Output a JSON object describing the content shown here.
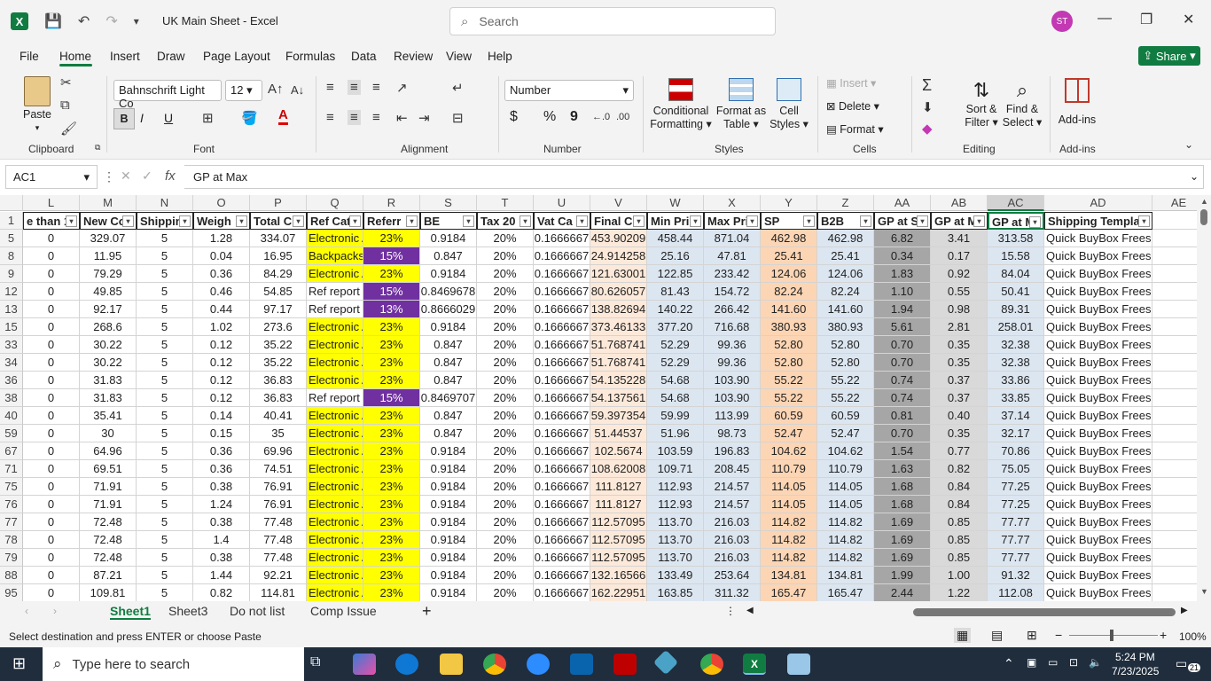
{
  "window": {
    "doc_title": "UK Main Sheet  -  Excel",
    "search_placeholder": "Search",
    "avatar": "ST",
    "minimize": "—",
    "maximize": "❐",
    "close": "✕"
  },
  "menu": {
    "file": "File",
    "home": "Home",
    "insert": "Insert",
    "draw": "Draw",
    "page_layout": "Page Layout",
    "formulas": "Formulas",
    "data": "Data",
    "review": "Review",
    "view": "View",
    "help": "Help",
    "share": "Share"
  },
  "ribbon": {
    "clipboard": {
      "paste": "Paste",
      "label": "Clipboard"
    },
    "font": {
      "name": "Bahnschrift Light Co",
      "size": "12",
      "label": "Font",
      "bold": "B",
      "italic": "I",
      "underline": "U"
    },
    "alignment": {
      "label": "Alignment"
    },
    "number": {
      "format": "Number",
      "label": "Number",
      "currency": "$",
      "percent": "%",
      "comma": "9"
    },
    "styles": {
      "conditional": "Conditional",
      "conditional2": "Formatting",
      "format_as": "Format as",
      "format_as2": "Table",
      "cell": "Cell",
      "cell2": "Styles",
      "label": "Styles"
    },
    "cells": {
      "insert": "Insert",
      "delete": "Delete",
      "format": "Format",
      "label": "Cells"
    },
    "editing": {
      "sort": "Sort &",
      "sort2": "Filter",
      "find": "Find &",
      "find2": "Select",
      "label": "Editing"
    },
    "addins": {
      "addins": "Add-ins",
      "label": "Add-ins"
    }
  },
  "formula_bar": {
    "name_box": "AC1",
    "content": "GP at Max",
    "fx": "fx"
  },
  "columns": [
    "L",
    "M",
    "N",
    "O",
    "P",
    "Q",
    "R",
    "S",
    "T",
    "U",
    "V",
    "W",
    "X",
    "Y",
    "Z",
    "AA",
    "AB",
    "AC",
    "AD",
    "AE"
  ],
  "headers": [
    "e than 1",
    "New Co",
    "Shippin",
    "Weigh",
    "Total C",
    "Ref Cat",
    "Referr",
    "BE",
    "Tax 20",
    "Vat Ca",
    "Final C",
    "Min Pri",
    "Max Pri",
    "SP",
    "B2B",
    "GP at S",
    "GP at M",
    "GP at M",
    "Shipping Templa"
  ],
  "row_numbers": [
    "1",
    "5",
    "8",
    "9",
    "12",
    "13",
    "15",
    "33",
    "34",
    "36",
    "38",
    "40",
    "59",
    "67",
    "71",
    "75",
    "76",
    "77",
    "78",
    "79",
    "88",
    "95"
  ],
  "rows": [
    [
      "0",
      "329.07",
      "5",
      "1.28",
      "334.07",
      "Electronic A",
      "23%",
      "0.9184",
      "20%",
      "0.1666667",
      "453.90209",
      "458.44",
      "871.04",
      "462.98",
      "462.98",
      "6.82",
      "3.41",
      "313.58",
      "Quick BuyBox Freeship"
    ],
    [
      "0",
      "11.95",
      "5",
      "0.04",
      "16.95",
      "Backpacks a",
      "15%",
      "0.847",
      "20%",
      "0.1666667",
      "24.914258",
      "25.16",
      "47.81",
      "25.41",
      "25.41",
      "0.34",
      "0.17",
      "15.58",
      "Quick BuyBox Freeship"
    ],
    [
      "0",
      "79.29",
      "5",
      "0.36",
      "84.29",
      "Electronic A",
      "23%",
      "0.9184",
      "20%",
      "0.1666667",
      "121.63001",
      "122.85",
      "233.42",
      "124.06",
      "124.06",
      "1.83",
      "0.92",
      "84.04",
      "Quick BuyBox Freeship"
    ],
    [
      "0",
      "49.85",
      "5",
      "0.46",
      "54.85",
      "Ref report",
      "15%",
      "0.8469678",
      "20%",
      "0.1666667",
      "80.626057",
      "81.43",
      "154.72",
      "82.24",
      "82.24",
      "1.10",
      "0.55",
      "50.41",
      "Quick BuyBox Freeship"
    ],
    [
      "0",
      "92.17",
      "5",
      "0.44",
      "97.17",
      "Ref report",
      "13%",
      "0.8666029",
      "20%",
      "0.1666667",
      "138.82694",
      "140.22",
      "266.42",
      "141.60",
      "141.60",
      "1.94",
      "0.98",
      "89.31",
      "Quick BuyBox Freeship"
    ],
    [
      "0",
      "268.6",
      "5",
      "1.02",
      "273.6",
      "Electronic A",
      "23%",
      "0.9184",
      "20%",
      "0.1666667",
      "373.46133",
      "377.20",
      "716.68",
      "380.93",
      "380.93",
      "5.61",
      "2.81",
      "258.01",
      "Quick BuyBox Freeship"
    ],
    [
      "0",
      "30.22",
      "5",
      "0.12",
      "35.22",
      "Electronic A",
      "23%",
      "0.847",
      "20%",
      "0.1666667",
      "51.768741",
      "52.29",
      "99.36",
      "52.80",
      "52.80",
      "0.70",
      "0.35",
      "32.38",
      "Quick BuyBox Freeship"
    ],
    [
      "0",
      "30.22",
      "5",
      "0.12",
      "35.22",
      "Electronic A",
      "23%",
      "0.847",
      "20%",
      "0.1666667",
      "51.768741",
      "52.29",
      "99.36",
      "52.80",
      "52.80",
      "0.70",
      "0.35",
      "32.38",
      "Quick BuyBox Freeship"
    ],
    [
      "0",
      "31.83",
      "5",
      "0.12",
      "36.83",
      "Electronic A",
      "23%",
      "0.847",
      "20%",
      "0.1666667",
      "54.135228",
      "54.68",
      "103.90",
      "55.22",
      "55.22",
      "0.74",
      "0.37",
      "33.86",
      "Quick BuyBox Freeship"
    ],
    [
      "0",
      "31.83",
      "5",
      "0.12",
      "36.83",
      "Ref report",
      "15%",
      "0.8469707",
      "20%",
      "0.1666667",
      "54.137561",
      "54.68",
      "103.90",
      "55.22",
      "55.22",
      "0.74",
      "0.37",
      "33.85",
      "Quick BuyBox Freeship"
    ],
    [
      "0",
      "35.41",
      "5",
      "0.14",
      "40.41",
      "Electronic A",
      "23%",
      "0.847",
      "20%",
      "0.1666667",
      "59.397354",
      "59.99",
      "113.99",
      "60.59",
      "60.59",
      "0.81",
      "0.40",
      "37.14",
      "Quick BuyBox Freeship"
    ],
    [
      "0",
      "30",
      "5",
      "0.15",
      "35",
      "Electronic A",
      "23%",
      "0.847",
      "20%",
      "0.1666667",
      "51.44537",
      "51.96",
      "98.73",
      "52.47",
      "52.47",
      "0.70",
      "0.35",
      "32.17",
      "Quick BuyBox Freeship"
    ],
    [
      "0",
      "64.96",
      "5",
      "0.36",
      "69.96",
      "Electronic A",
      "23%",
      "0.9184",
      "20%",
      "0.1666667",
      "102.5674",
      "103.59",
      "196.83",
      "104.62",
      "104.62",
      "1.54",
      "0.77",
      "70.86",
      "Quick BuyBox Freeship"
    ],
    [
      "0",
      "69.51",
      "5",
      "0.36",
      "74.51",
      "Electronic A",
      "23%",
      "0.9184",
      "20%",
      "0.1666667",
      "108.62008",
      "109.71",
      "208.45",
      "110.79",
      "110.79",
      "1.63",
      "0.82",
      "75.05",
      "Quick BuyBox Freeship"
    ],
    [
      "0",
      "71.91",
      "5",
      "0.38",
      "76.91",
      "Electronic A",
      "23%",
      "0.9184",
      "20%",
      "0.1666667",
      "111.8127",
      "112.93",
      "214.57",
      "114.05",
      "114.05",
      "1.68",
      "0.84",
      "77.25",
      "Quick BuyBox Freeship"
    ],
    [
      "0",
      "71.91",
      "5",
      "1.24",
      "76.91",
      "Electronic A",
      "23%",
      "0.9184",
      "20%",
      "0.1666667",
      "111.8127",
      "112.93",
      "214.57",
      "114.05",
      "114.05",
      "1.68",
      "0.84",
      "77.25",
      "Quick BuyBox Freeship"
    ],
    [
      "0",
      "72.48",
      "5",
      "0.38",
      "77.48",
      "Electronic A",
      "23%",
      "0.9184",
      "20%",
      "0.1666667",
      "112.57095",
      "113.70",
      "216.03",
      "114.82",
      "114.82",
      "1.69",
      "0.85",
      "77.77",
      "Quick BuyBox Freeship"
    ],
    [
      "0",
      "72.48",
      "5",
      "1.4",
      "77.48",
      "Electronic A",
      "23%",
      "0.9184",
      "20%",
      "0.1666667",
      "112.57095",
      "113.70",
      "216.03",
      "114.82",
      "114.82",
      "1.69",
      "0.85",
      "77.77",
      "Quick BuyBox Freeship"
    ],
    [
      "0",
      "72.48",
      "5",
      "0.38",
      "77.48",
      "Electronic A",
      "23%",
      "0.9184",
      "20%",
      "0.1666667",
      "112.57095",
      "113.70",
      "216.03",
      "114.82",
      "114.82",
      "1.69",
      "0.85",
      "77.77",
      "Quick BuyBox Freeship"
    ],
    [
      "0",
      "87.21",
      "5",
      "1.44",
      "92.21",
      "Electronic A",
      "23%",
      "0.9184",
      "20%",
      "0.1666667",
      "132.16566",
      "133.49",
      "253.64",
      "134.81",
      "134.81",
      "1.99",
      "1.00",
      "91.32",
      "Quick BuyBox Freeship"
    ],
    [
      "0",
      "109.81",
      "5",
      "0.82",
      "114.81",
      "Electronic A",
      "23%",
      "0.9184",
      "20%",
      "0.1666667",
      "162.22951",
      "163.85",
      "311.32",
      "165.47",
      "165.47",
      "2.44",
      "1.22",
      "112.08",
      "Quick BuyBox Freeship"
    ]
  ],
  "colors": {
    "yellow": "#ffff00",
    "purple": "#7030a0",
    "peach": "#fde9d9",
    "lightblue": "#dce6f1",
    "orange": "#fcd5b4",
    "gray": "#a6a6a6",
    "green": "#107c41"
  },
  "sheets": [
    "Sheet1",
    "Sheet3",
    "Do not list",
    "Comp Issue"
  ],
  "status": {
    "text": "Select destination and press ENTER or choose Paste",
    "zoom": "100%"
  },
  "taskbar": {
    "search": "Type here to search",
    "time": "5:24 PM",
    "date": "7/23/2025",
    "notif": "21"
  }
}
